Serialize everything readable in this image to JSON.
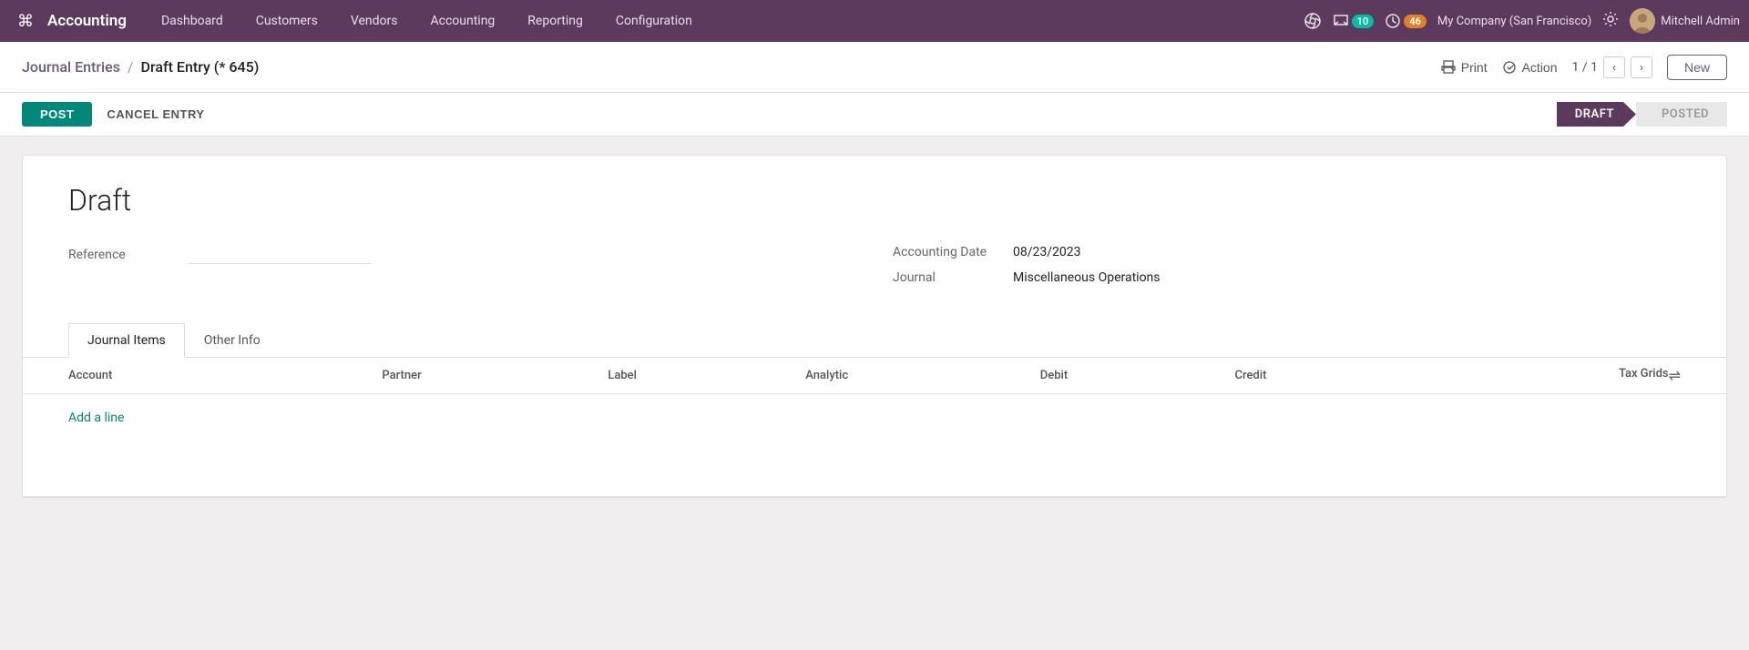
{
  "topnav": {
    "brand": "Accounting",
    "menu": [
      {
        "label": "Dashboard",
        "id": "dashboard"
      },
      {
        "label": "Customers",
        "id": "customers"
      },
      {
        "label": "Vendors",
        "id": "vendors"
      },
      {
        "label": "Accounting",
        "id": "accounting"
      },
      {
        "label": "Reporting",
        "id": "reporting"
      },
      {
        "label": "Configuration",
        "id": "configuration"
      }
    ],
    "messages_count": "10",
    "activities_count": "46",
    "company": "My Company (San Francisco)",
    "user": "Mitchell Admin"
  },
  "header": {
    "breadcrumb_link": "Journal Entries",
    "breadcrumb_sep": "/",
    "breadcrumb_current": "Draft Entry (* 645)",
    "print_label": "Print",
    "action_label": "Action",
    "pager": "1 / 1",
    "new_label": "New"
  },
  "action_bar": {
    "post_label": "POST",
    "cancel_label": "CANCEL ENTRY",
    "status_draft": "DRAFT",
    "status_posted": "POSTED"
  },
  "form": {
    "title": "Draft",
    "reference_label": "Reference",
    "reference_value": "",
    "accounting_date_label": "Accounting Date",
    "accounting_date_value": "08/23/2023",
    "journal_label": "Journal",
    "journal_value": "Miscellaneous Operations"
  },
  "tabs": [
    {
      "label": "Journal Items",
      "id": "journal-items",
      "active": true
    },
    {
      "label": "Other Info",
      "id": "other-info",
      "active": false
    }
  ],
  "table": {
    "columns": [
      "Account",
      "Partner",
      "Label",
      "Analytic",
      "Debit",
      "Credit",
      "Tax Grids"
    ],
    "add_line_label": "Add a line",
    "adjust_icon": "⇄"
  }
}
